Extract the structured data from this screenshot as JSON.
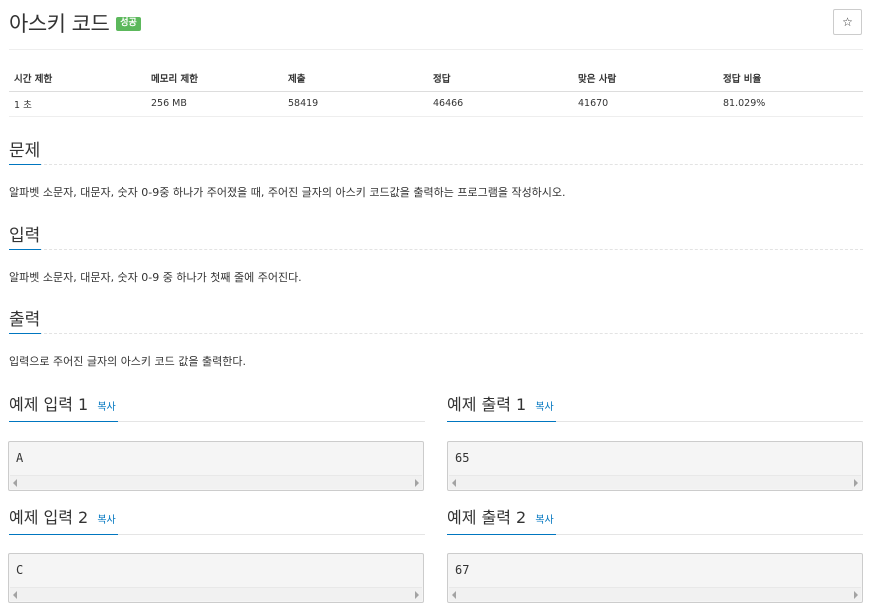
{
  "problem": {
    "title": "아스키 코드",
    "badge": "성공",
    "star_icon": "☆"
  },
  "info_table": {
    "headers": [
      "시간 제한",
      "메모리 제한",
      "제출",
      "정답",
      "맞은 사람",
      "정답 비율"
    ],
    "values": [
      "1 초",
      "256 MB",
      "58419",
      "46466",
      "41670",
      "81.029%"
    ]
  },
  "sections": {
    "description": {
      "title": "문제",
      "text": "알파벳 소문자, 대문자, 숫자 0-9중 하나가 주어졌을 때, 주어진 글자의 아스키 코드값을 출력하는 프로그램을 작성하시오."
    },
    "input": {
      "title": "입력",
      "text": "알파벳 소문자, 대문자, 숫자 0-9 중 하나가 첫째 줄에 주어진다."
    },
    "output": {
      "title": "출력",
      "text": "입력으로 주어진 글자의 아스키 코드 값을 출력한다."
    }
  },
  "samples": {
    "copy_label": "복사",
    "input1": {
      "title": "예제 입력 1",
      "value": "A"
    },
    "output1": {
      "title": "예제 출력 1",
      "value": "65"
    },
    "input2": {
      "title": "예제 입력 2",
      "value": "C"
    },
    "output2": {
      "title": "예제 출력 2",
      "value": "67"
    }
  },
  "colors": {
    "accent": "#0076c0",
    "badge": "#5cb85c"
  }
}
